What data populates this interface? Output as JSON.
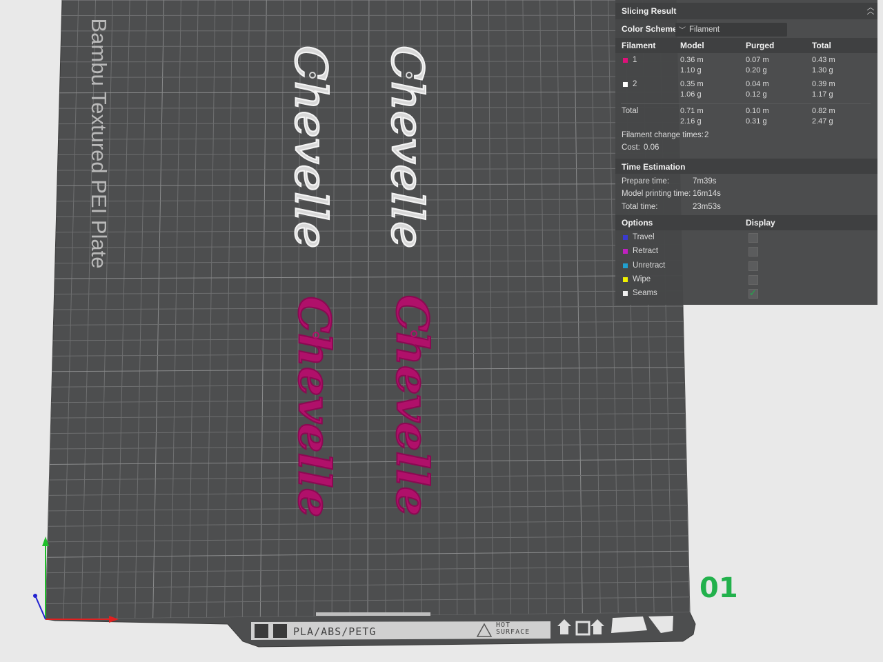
{
  "plate": {
    "label": "Bambu Textured PEI Plate",
    "number": "01",
    "filament_types": "PLA/ABS/PETG",
    "hot_surface": [
      "HOT",
      "SURFACE"
    ]
  },
  "models": {
    "text": "Chevelle",
    "colors": {
      "white": "#d8d8d8",
      "magenta": "#b0106a"
    }
  },
  "slicing_result": {
    "title": "Slicing Result",
    "collapse_icon": "double-chevron-up-icon",
    "color_scheme": {
      "label": "Color Scheme",
      "value": "Filament"
    },
    "table": {
      "headers": [
        "Filament",
        "Model",
        "Purged",
        "Total"
      ],
      "rows": [
        {
          "id": "1",
          "color": "#e0107a",
          "model": [
            "0.36 m",
            "1.10 g"
          ],
          "purged": [
            "0.07 m",
            "0.20 g"
          ],
          "total": [
            "0.43 m",
            "1.30 g"
          ]
        },
        {
          "id": "2",
          "color": "#ffffff",
          "model": [
            "0.35 m",
            "1.06 g"
          ],
          "purged": [
            "0.04 m",
            "0.12 g"
          ],
          "total": [
            "0.39 m",
            "1.17 g"
          ]
        }
      ],
      "total_row": {
        "label": "Total",
        "model": [
          "0.71 m",
          "2.16 g"
        ],
        "purged": [
          "0.10 m",
          "0.31 g"
        ],
        "total": [
          "0.82 m",
          "2.47 g"
        ]
      }
    },
    "filament_change": {
      "label": "Filament change times:",
      "value": "2"
    },
    "cost": {
      "label": "Cost:",
      "value": "0.06"
    },
    "time_estimation": {
      "title": "Time Estimation",
      "rows": [
        {
          "label": "Prepare time:",
          "value": "7m39s"
        },
        {
          "label": "Model printing time:",
          "value": "16m14s"
        },
        {
          "label": "Total time:",
          "value": "23m53s"
        }
      ]
    },
    "options": {
      "title": "Options",
      "display_title": "Display",
      "items": [
        {
          "label": "Travel",
          "color": "#3a3ad0",
          "checked": false
        },
        {
          "label": "Retract",
          "color": "#c020c0",
          "checked": false
        },
        {
          "label": "Unretract",
          "color": "#20a0d0",
          "checked": false
        },
        {
          "label": "Wipe",
          "color": "#f0f000",
          "checked": false
        },
        {
          "label": "Seams",
          "color": "#f0f0f0",
          "checked": true
        }
      ]
    }
  }
}
